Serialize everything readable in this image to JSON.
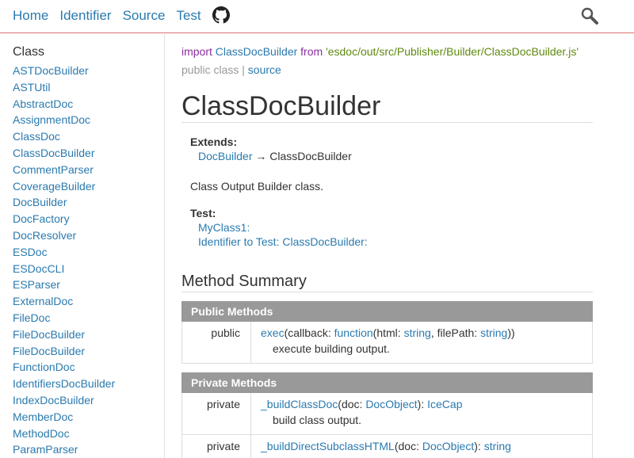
{
  "nav": {
    "home": "Home",
    "identifier": "Identifier",
    "source": "Source",
    "test": "Test"
  },
  "sidebar": {
    "title": "Class",
    "items": [
      "ASTDocBuilder",
      "ASTUtil",
      "AbstractDoc",
      "AssignmentDoc",
      "ClassDoc",
      "ClassDocBuilder",
      "CommentParser",
      "CoverageBuilder",
      "DocBuilder",
      "DocFactory",
      "DocResolver",
      "ESDoc",
      "ESDocCLI",
      "ESParser",
      "ExternalDoc",
      "FileDoc",
      "FileDocBuilder",
      "FileDocBuilder",
      "FunctionDoc",
      "IdentifiersDocBuilder",
      "IndexDocBuilder",
      "MemberDoc",
      "MethodDoc",
      "ParamParser"
    ]
  },
  "content": {
    "import_kw": "import",
    "import_name": "ClassDocBuilder",
    "from_kw": "from",
    "import_path": "'esdoc/out/src/Publisher/Builder/ClassDocBuilder.js'",
    "meta_kind": "public class",
    "meta_sep": "|",
    "meta_source": "source",
    "title": "ClassDocBuilder",
    "extends_label": "Extends:",
    "extends_parent": "DocBuilder",
    "extends_arrow": "→",
    "extends_self": "ClassDocBuilder",
    "description": "Class Output Builder class.",
    "test_label": "Test:",
    "test_items": [
      "MyClass1:",
      "Identifier to Test: ClassDocBuilder:"
    ],
    "method_summary_title": "Method Summary",
    "public_header": "Public Methods",
    "private_header": "Private Methods"
  },
  "methods": {
    "exec": {
      "access": "public",
      "name": "exec",
      "p1": "callback",
      "t1": "function",
      "p1b": "html",
      "t1b": "string",
      "p2": "filePath",
      "t2": "string",
      "desc": "execute building output."
    },
    "buildClassDoc": {
      "access": "private",
      "name": "_buildClassDoc",
      "p1": "doc",
      "t1": "DocObject",
      "ret": "IceCap",
      "desc": "build class output."
    },
    "buildDirectSubclassHTML": {
      "access": "private",
      "name": "_buildDirectSubclassHTML",
      "p1": "doc",
      "t1": "DocObject",
      "ret": "string"
    }
  },
  "colors": {
    "link": "#2a7aaf",
    "keyword": "#8a2e9e",
    "string": "#5f8a0f",
    "header_border": "#e07070",
    "table_header_bg": "#999999"
  },
  "icons": {
    "github": "github-icon",
    "search": "search-icon"
  }
}
